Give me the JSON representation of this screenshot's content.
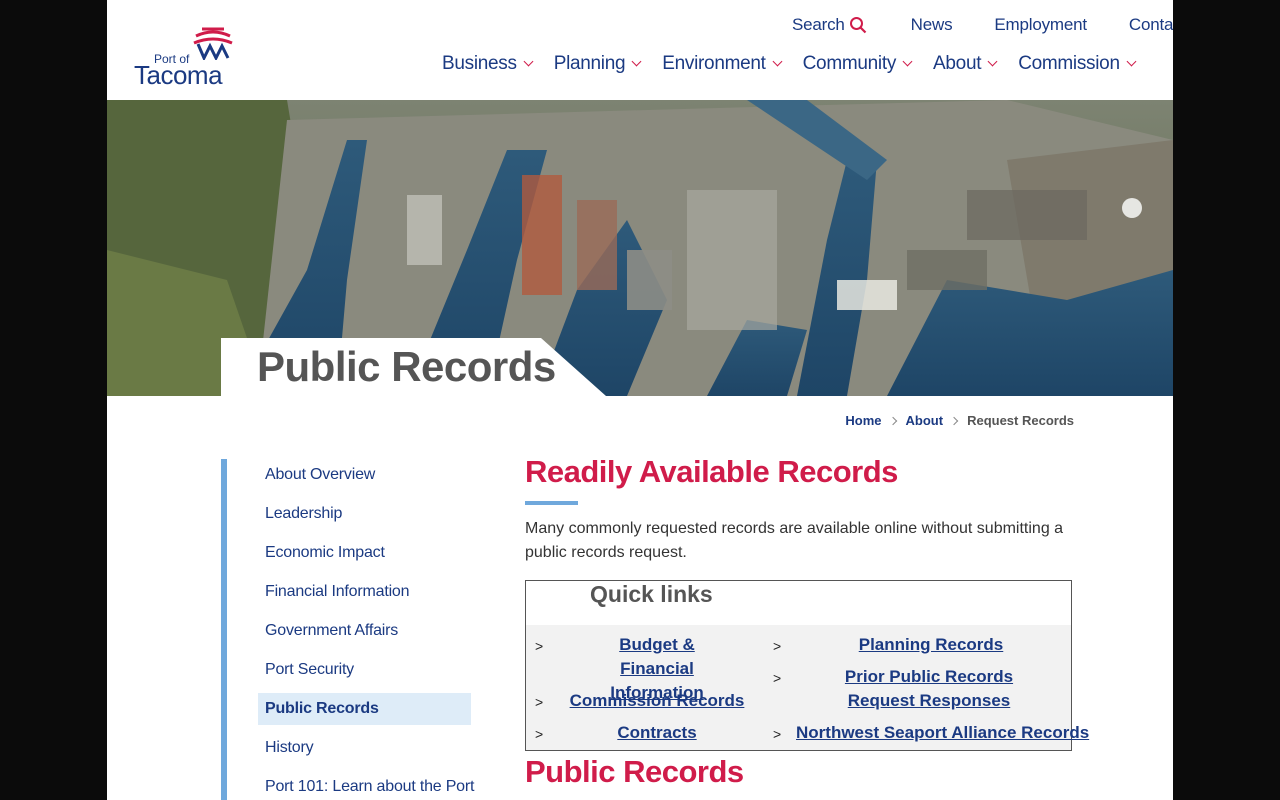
{
  "logo": {
    "small": "Port of",
    "large": "Tacoma"
  },
  "utility_nav": {
    "search": "Search",
    "news": "News",
    "employment": "Employment",
    "contact": "Contact"
  },
  "main_nav": [
    "Business",
    "Planning",
    "Environment",
    "Community",
    "About",
    "Commission"
  ],
  "hero": {
    "title": "Public Records"
  },
  "breadcrumb": {
    "home": "Home",
    "about": "About",
    "current": "Request Records"
  },
  "sidebar": {
    "items": [
      {
        "label": "About Overview"
      },
      {
        "label": "Leadership"
      },
      {
        "label": "Economic Impact"
      },
      {
        "label": "Financial Information"
      },
      {
        "label": "Government Affairs"
      },
      {
        "label": "Port Security"
      },
      {
        "label": "Public Records",
        "active": true
      },
      {
        "label": "History"
      },
      {
        "label": "Port 101: Learn about the Port"
      }
    ]
  },
  "content": {
    "heading": "Readily Available Records",
    "intro": "Many commonly requested records are available online without submitting a public records request.",
    "quick_links": {
      "title": "Quick links",
      "marker": ">",
      "left": [
        "Budget & Financial Information",
        "Commission Records",
        "Contracts"
      ],
      "right": [
        "Planning Records",
        "Prior Public Records Request Responses",
        "Northwest Seaport Alliance Records"
      ]
    },
    "heading2": "Public Records"
  },
  "colors": {
    "brand_navy": "#1b3a82",
    "accent_red": "#d01c4a",
    "accent_blue": "#6fa8dc",
    "active_bg": "#deecf8"
  }
}
